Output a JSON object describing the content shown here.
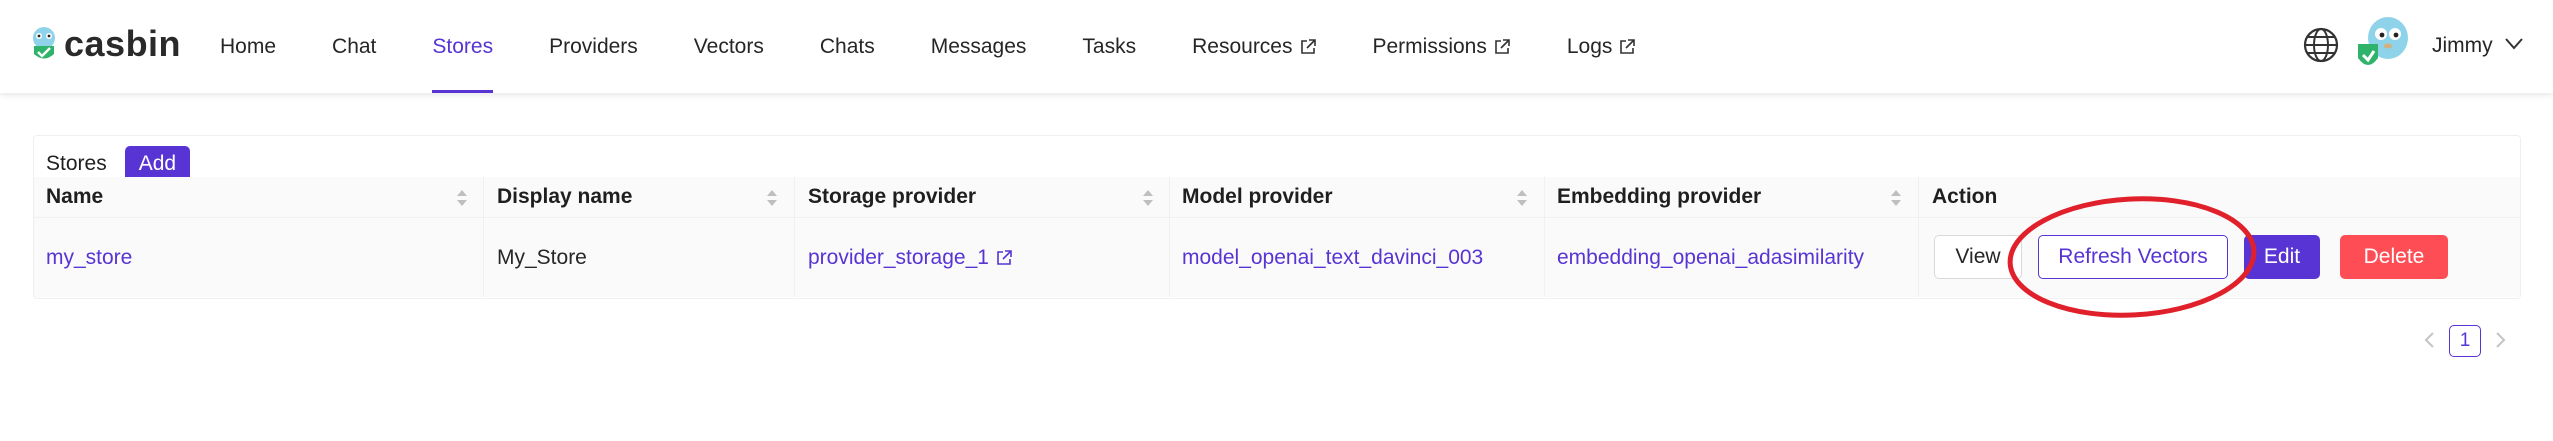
{
  "brand": {
    "name": "casbin"
  },
  "nav": [
    {
      "label": "Home",
      "active": false,
      "external": false
    },
    {
      "label": "Chat",
      "active": false,
      "external": false
    },
    {
      "label": "Stores",
      "active": true,
      "external": false
    },
    {
      "label": "Providers",
      "active": false,
      "external": false
    },
    {
      "label": "Vectors",
      "active": false,
      "external": false
    },
    {
      "label": "Chats",
      "active": false,
      "external": false
    },
    {
      "label": "Messages",
      "active": false,
      "external": false
    },
    {
      "label": "Tasks",
      "active": false,
      "external": false
    },
    {
      "label": "Resources",
      "active": false,
      "external": true
    },
    {
      "label": "Permissions",
      "active": false,
      "external": true
    },
    {
      "label": "Logs",
      "active": false,
      "external": true
    }
  ],
  "user": {
    "name": "Jimmy"
  },
  "table": {
    "title": "Stores",
    "add_label": "Add",
    "columns": [
      "Name",
      "Display name",
      "Storage provider",
      "Model provider",
      "Embedding provider",
      "Action"
    ],
    "rows": [
      {
        "name": "my_store",
        "display_name": "My_Store",
        "storage_provider": "provider_storage_1",
        "model_provider": "model_openai_text_davinci_003",
        "embedding_provider": "embedding_openai_adasimilarity"
      }
    ],
    "actions": {
      "view": "View",
      "refresh": "Refresh Vectors",
      "edit": "Edit",
      "delete": "Delete"
    }
  },
  "pagination": {
    "current_page": "1"
  },
  "colors": {
    "accent": "#5734d3",
    "danger": "#ff4d55",
    "highlight_circle": "#e0202a"
  }
}
